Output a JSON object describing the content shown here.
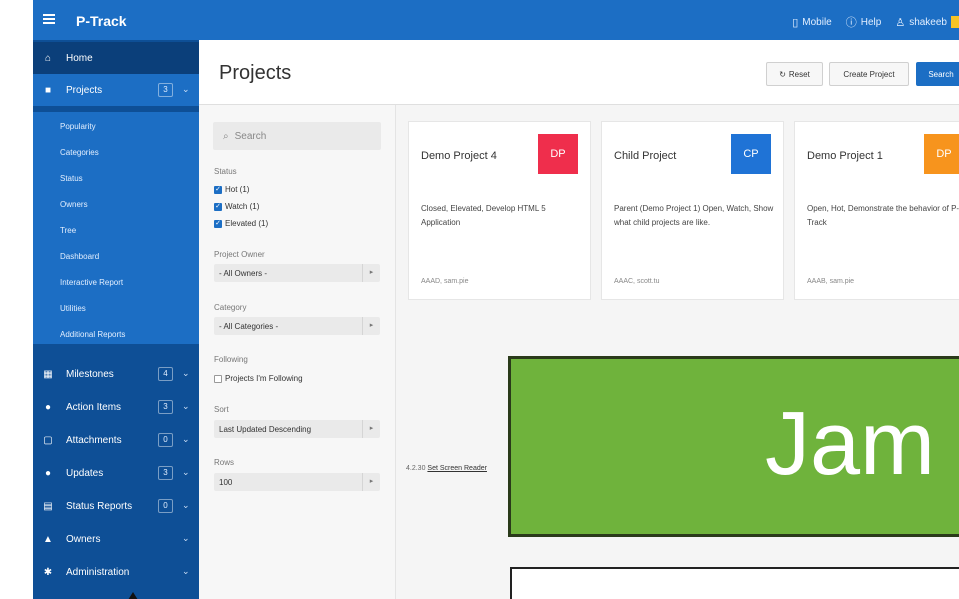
{
  "topbar": {
    "title": "P-Track",
    "links": [
      {
        "label": "Mobile",
        "icon": "mobile-icon",
        "glyph": "▯"
      },
      {
        "label": "Help",
        "icon": "help-icon",
        "glyph": "ⓘ"
      },
      {
        "label": "shakeeb",
        "icon": "user-icon",
        "glyph": "♙"
      }
    ]
  },
  "sidebar": {
    "items": [
      {
        "label": "Home",
        "icon": "home-icon",
        "glyph": "⌂"
      },
      {
        "label": "Projects",
        "icon": "projects-icon",
        "glyph": "■",
        "count": "3"
      },
      {
        "label": "Milestones",
        "icon": "calendar-icon",
        "glyph": "▦",
        "count": "4"
      },
      {
        "label": "Action Items",
        "icon": "action-icon",
        "glyph": "●",
        "count": "3"
      },
      {
        "label": "Attachments",
        "icon": "attachment-icon",
        "glyph": "▢",
        "count": "0"
      },
      {
        "label": "Updates",
        "icon": "chat-icon",
        "glyph": "●",
        "count": "3"
      },
      {
        "label": "Status Reports",
        "icon": "report-icon",
        "glyph": "▤",
        "count": "0"
      },
      {
        "label": "Owners",
        "icon": "owner-icon",
        "glyph": "▲"
      },
      {
        "label": "Administration",
        "icon": "gear-icon",
        "glyph": "✱"
      }
    ],
    "sub_items": [
      "Popularity",
      "Categories",
      "Status",
      "Owners",
      "Tree",
      "Dashboard",
      "Interactive Report",
      "Utilities",
      "Additional Reports"
    ]
  },
  "header": {
    "title": "Projects",
    "reset_label": "Reset",
    "create_label": "Create Project",
    "search_label": "Search"
  },
  "filters": {
    "search_placeholder": "Search",
    "status_label": "Status",
    "status_options": [
      {
        "label": "Hot (1)",
        "checked": true
      },
      {
        "label": "Watch (1)",
        "checked": true
      },
      {
        "label": "Elevated (1)",
        "checked": true
      }
    ],
    "owner_label": "Project Owner",
    "owner_value": "- All Owners -",
    "category_label": "Category",
    "category_value": "- All Categories -",
    "following_label": "Following",
    "following_option": "Projects I'm Following",
    "sort_label": "Sort",
    "sort_value": "Last Updated Descending",
    "rows_label": "Rows",
    "rows_value": "100"
  },
  "cards": [
    {
      "title": "Demo Project 4",
      "badge": "DP",
      "badge_color": "#ef2e4c",
      "description": "Closed, Elevated, Develop HTML 5 Application",
      "meta": "AAAD, sam.pie"
    },
    {
      "title": "Child Project",
      "badge": "CP",
      "badge_color": "#1f73d6",
      "description": "Parent (Demo Project 1) Open, Watch, Show what child projects are like.",
      "meta": "AAAC, scott.tu"
    },
    {
      "title": "Demo Project 1",
      "badge": "DP",
      "badge_color": "#f7941d",
      "description": "Open, Hot, Demonstrate the behavior of P-Track",
      "meta": "AAAB, sam.pie"
    }
  ],
  "footer": {
    "version": "4.2.30",
    "link_text": "Set Screen Reader"
  },
  "overlay": {
    "text": "Jam"
  },
  "colors": {
    "topbar": "#1c6ec4",
    "sidebar": "#0e4f96",
    "overlay_green": "#6fb33c"
  }
}
